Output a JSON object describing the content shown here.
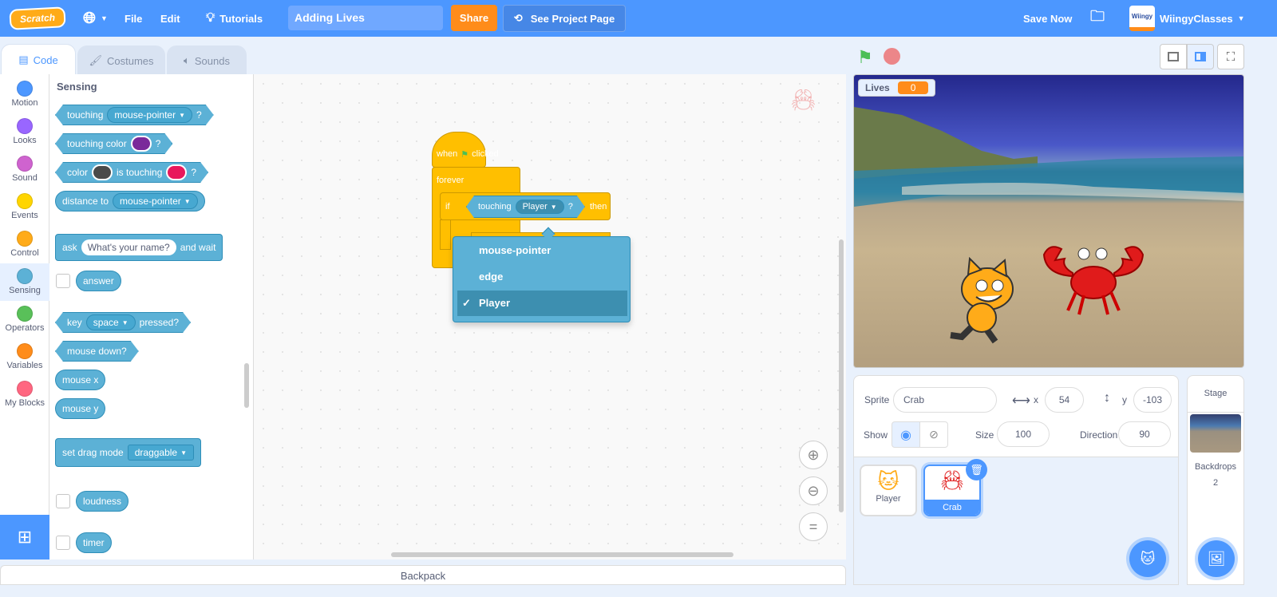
{
  "header": {
    "logo": "Scratch",
    "language_icon": "globe-icon",
    "file": "File",
    "edit": "Edit",
    "tutorials": "Tutorials",
    "project_title": "Adding Lives",
    "share": "Share",
    "see_project_page": "See Project Page",
    "save_now": "Save Now",
    "username": "WiingyClasses",
    "avatar_text": "Wiingy"
  },
  "tabs": [
    {
      "label": "Code",
      "active": true
    },
    {
      "label": "Costumes"
    },
    {
      "label": "Sounds"
    }
  ],
  "categories": [
    {
      "label": "Motion",
      "color": "#4c97ff"
    },
    {
      "label": "Looks",
      "color": "#9966ff"
    },
    {
      "label": "Sound",
      "color": "#cf63cf"
    },
    {
      "label": "Events",
      "color": "#ffd500"
    },
    {
      "label": "Control",
      "color": "#ffab19"
    },
    {
      "label": "Sensing",
      "color": "#5cb1d6",
      "selected": true
    },
    {
      "label": "Operators",
      "color": "#59c059"
    },
    {
      "label": "Variables",
      "color": "#ff8c1a"
    },
    {
      "label": "My Blocks",
      "color": "#ff6680"
    }
  ],
  "palette": {
    "heading": "Sensing",
    "touching": {
      "label": "touching",
      "menu": "mouse-pointer",
      "q": "?"
    },
    "touching_color": {
      "label": "touching color",
      "q": "?",
      "color": "#7a2a9a"
    },
    "color_touching": {
      "label": "color",
      "mid": "is touching",
      "q": "?",
      "color1": "#4a4a4a",
      "color2": "#e8185c"
    },
    "distance": {
      "label": "distance to",
      "menu": "mouse-pointer"
    },
    "ask": {
      "label": "ask",
      "input": "What's your name?",
      "suffix": "and wait"
    },
    "answer": "answer",
    "key": {
      "label": "key",
      "menu": "space",
      "suffix": "pressed?"
    },
    "mouse_down": "mouse down?",
    "mouse_x": "mouse x",
    "mouse_y": "mouse y",
    "drag": {
      "label": "set drag mode",
      "menu": "draggable"
    },
    "loudness": "loudness",
    "timer": "timer"
  },
  "script": {
    "when": "when",
    "clicked": "clicked",
    "forever": "forever",
    "if": "if",
    "touching": "touching",
    "target": "Player",
    "q": "?",
    "then": "then"
  },
  "dropdown": {
    "items": [
      "mouse-pointer",
      "edge",
      "Player"
    ],
    "selected": "Player",
    "check": "✓"
  },
  "backpack": "Backpack",
  "stage": {
    "monitor_label": "Lives",
    "monitor_value": "0"
  },
  "sprite_info": {
    "sprite_label": "Sprite",
    "sprite_name": "Crab",
    "x_label": "x",
    "x": "54",
    "y_label": "y",
    "y": "-103",
    "show_label": "Show",
    "size_label": "Size",
    "size": "100",
    "direction_label": "Direction",
    "direction": "90"
  },
  "sprites": [
    {
      "name": "Player"
    },
    {
      "name": "Crab",
      "selected": true
    }
  ],
  "stage_panel": {
    "title": "Stage",
    "backdrops_label": "Backdrops",
    "backdrops_count": "2"
  }
}
